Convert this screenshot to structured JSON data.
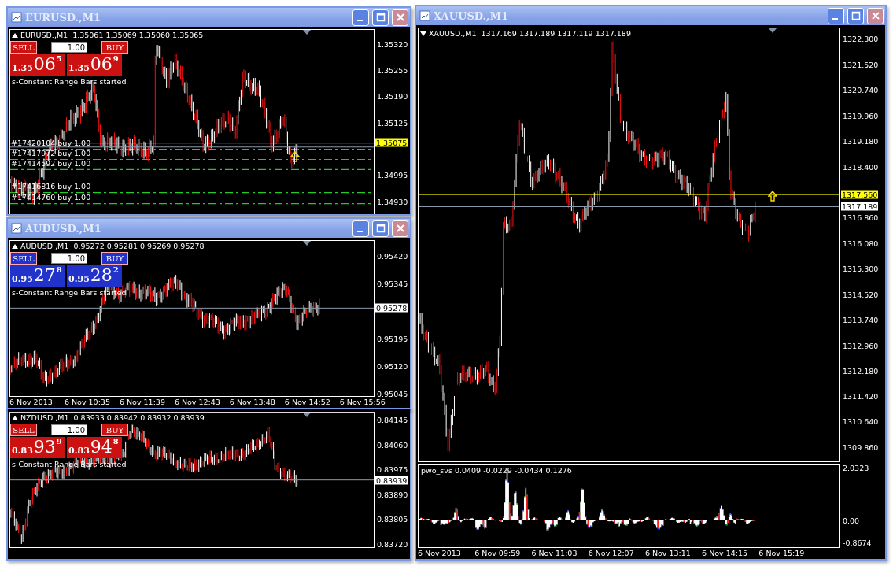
{
  "windows": [
    {
      "title": "EURUSD.,M1",
      "chart": {
        "symbol": "EURUSD.,M1",
        "ohlc": [
          "1.35061",
          "1.35069",
          "1.35060",
          "1.35065"
        ],
        "trade_panel": {
          "color": "#cc1111",
          "sell": "SELL",
          "buy": "BUY",
          "lots": "1.00",
          "sell_price": {
            "prefix": "1.35",
            "big": "06",
            "pip": "5"
          },
          "buy_price": {
            "prefix": "1.35",
            "big": "06",
            "pip": "9"
          }
        },
        "status": "s-Constant Range Bars started",
        "orders": [
          "#17420104 buy 1.00",
          "#17417972 buy 1.00",
          "#17414592 buy 1.00",
          "#17416816 buy 1.00",
          "#17414760 buy 1.00"
        ],
        "yticks": [
          "1.35320",
          "1.35255",
          "1.35190",
          "1.35125",
          "1.34995",
          "1.34930"
        ],
        "tags": [
          {
            "text": "1.35075",
            "kind": "alert"
          }
        ]
      }
    },
    {
      "title": "AUDUSD.,M1",
      "chart": {
        "symbol": "AUDUSD.,M1",
        "ohlc": [
          "0.95272",
          "0.95281",
          "0.95269",
          "0.95278"
        ],
        "trade_panel": {
          "color": "#2233cc",
          "sell": "SELL",
          "buy": "BUY",
          "lots": "1.00",
          "sell_price": {
            "prefix": "0.95",
            "big": "27",
            "pip": "8"
          },
          "buy_price": {
            "prefix": "0.95",
            "big": "28",
            "pip": "2"
          }
        },
        "status": "s-Constant Range Bars started",
        "yticks": [
          "0.95420",
          "0.95345",
          "0.95195",
          "0.95120",
          "0.95045"
        ],
        "tags": [
          {
            "text": "0.95278",
            "kind": "bid"
          }
        ],
        "time_labels": [
          "6 Nov 2013",
          "6 Nov 10:35",
          "6 Nov 11:39",
          "6 Nov 12:43",
          "6 Nov 13:48",
          "6 Nov 14:52",
          "6 Nov 15:56"
        ]
      }
    },
    {
      "chart": {
        "symbol": "NZDUSD.,M1",
        "ohlc": [
          "0.83933",
          "0.83942",
          "0.83932",
          "0.83939"
        ],
        "trade_panel": {
          "color": "#cc1111",
          "sell": "SELL",
          "buy": "BUY",
          "lots": "1.00",
          "sell_price": {
            "prefix": "0.83",
            "big": "93",
            "pip": "9"
          },
          "buy_price": {
            "prefix": "0.83",
            "big": "94",
            "pip": "8"
          }
        },
        "status": "s-Constant Range Bars started",
        "yticks": [
          "0.84145",
          "0.84060",
          "0.83975",
          "0.83890",
          "0.83805",
          "0.83720"
        ],
        "tags": [
          {
            "text": "0.83939",
            "kind": "bid"
          }
        ]
      }
    },
    {
      "title": "XAUUSD.,M1",
      "chart": {
        "symbol": "XAUUSD.,M1",
        "ohlc": [
          "1317.169",
          "1317.189",
          "1317.119",
          "1317.189"
        ],
        "yticks": [
          "1322.300",
          "1321.520",
          "1320.740",
          "1319.960",
          "1319.180",
          "1318.400",
          "1316.860",
          "1316.080",
          "1315.300",
          "1314.520",
          "1313.740",
          "1312.960",
          "1312.180",
          "1311.420",
          "1310.640",
          "1309.860"
        ],
        "tags": [
          {
            "text": "1317.560",
            "kind": "alert"
          },
          {
            "text": "1317.189",
            "kind": "bid"
          }
        ],
        "indicator": {
          "name": "pwo_svs",
          "values": [
            "0.0409",
            "-0.0229",
            "-0.0434",
            "0.1276"
          ],
          "yticks": [
            "2.0323",
            "0.00",
            "-0.8674"
          ]
        },
        "time_labels": [
          "6 Nov 2013",
          "6 Nov 09:59",
          "6 Nov 11:03",
          "6 Nov 12:07",
          "6 Nov 13:11",
          "6 Nov 14:15",
          "6 Nov 15:19"
        ]
      }
    }
  ]
}
